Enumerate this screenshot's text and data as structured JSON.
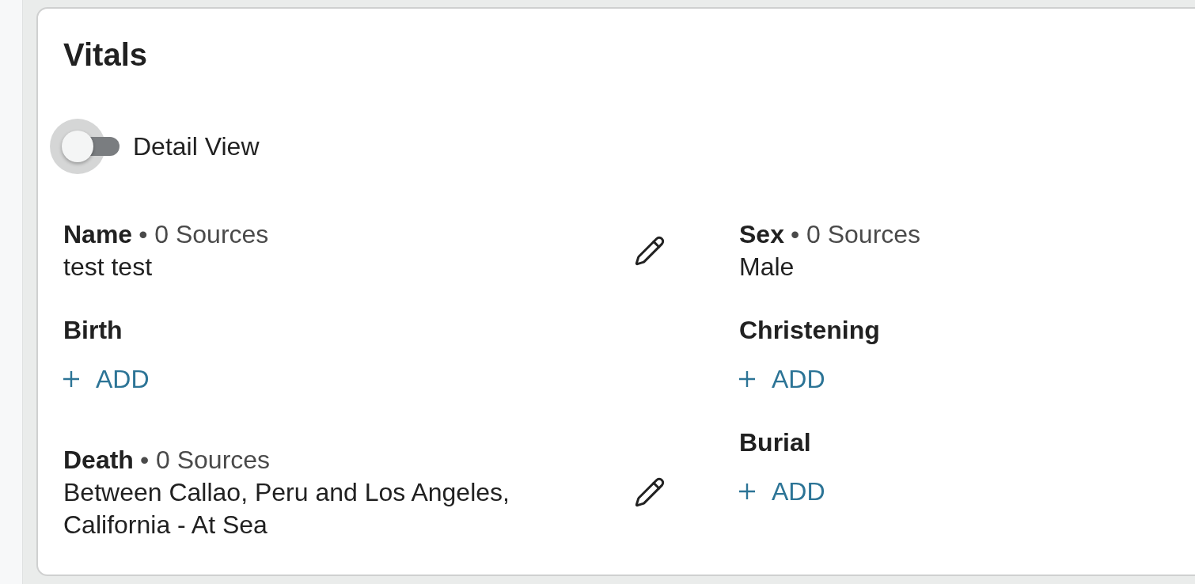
{
  "section": {
    "title": "Vitals"
  },
  "detail_view": {
    "label": "Detail View",
    "on": false
  },
  "columns": [
    {
      "items": [
        {
          "kind": "fact",
          "label": "Name",
          "sources": "• 0 Sources",
          "value": "test test",
          "editable": true
        },
        {
          "kind": "empty",
          "label": "Birth",
          "add_label": "ADD"
        },
        {
          "kind": "fact",
          "label": "Death",
          "sources": "• 0 Sources",
          "value": "Between Callao, Peru and Los Angeles, California - At Sea",
          "editable": true
        }
      ]
    },
    {
      "items": [
        {
          "kind": "fact",
          "label": "Sex",
          "sources": "• 0 Sources",
          "value": "Male",
          "editable": false
        },
        {
          "kind": "empty",
          "label": "Christening",
          "add_label": "ADD"
        },
        {
          "kind": "empty",
          "label": "Burial",
          "add_label": "ADD"
        }
      ]
    }
  ]
}
